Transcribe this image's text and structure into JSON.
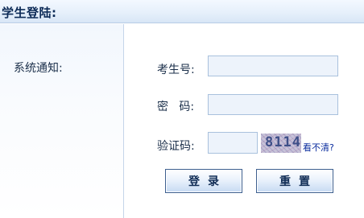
{
  "header": {
    "title": "学生登陆:"
  },
  "sidebar": {
    "notice_label": "系统通知:"
  },
  "form": {
    "student_id": {
      "label": "考生号:",
      "value": ""
    },
    "password": {
      "label": "密   码:",
      "value": ""
    },
    "captcha": {
      "label": "验证码:",
      "value": "",
      "image_text": "8114",
      "refresh_link": "看不清?"
    }
  },
  "buttons": {
    "login": "登录",
    "reset": "重置"
  }
}
